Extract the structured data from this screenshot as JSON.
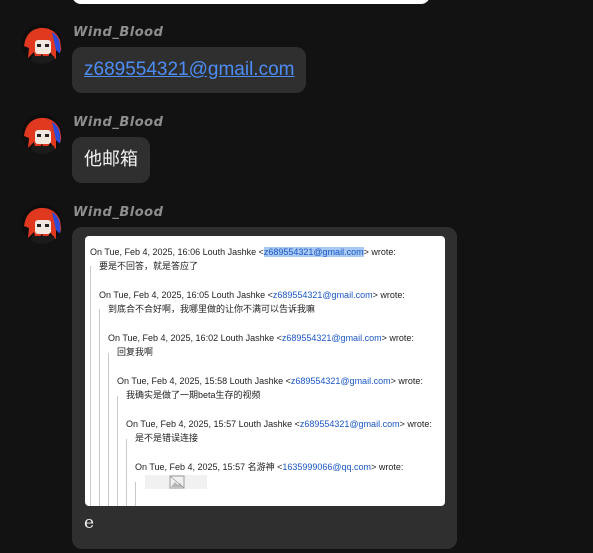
{
  "messages": [
    {
      "author": "Wind_Blood",
      "text": "z689554321@gmail.com",
      "type": "link"
    },
    {
      "author": "Wind_Blood",
      "text": "他邮箱",
      "type": "text"
    },
    {
      "author": "Wind_Blood",
      "type": "image",
      "caption": "e",
      "screenshot": {
        "quotes": [
          {
            "header_pre": "On Tue, Feb 4, 2025, 16:06 Louth Jashke <",
            "email": "z689554321@gmail.com",
            "header_post": "> wrote:",
            "body": "要是不回答，就是答应了"
          },
          {
            "header_pre": "On Tue, Feb 4, 2025, 16:05 Louth Jashke <",
            "email": "z689554321@gmail.com",
            "header_post": "> wrote:",
            "body": "到底合不合好啊，我哪里做的让你不满可以告诉我嘛"
          },
          {
            "header_pre": "On Tue, Feb 4, 2025, 16:02 Louth Jashke <",
            "email": "z689554321@gmail.com",
            "header_post": "> wrote:",
            "body": "回复我啊"
          },
          {
            "header_pre": "On Tue, Feb 4, 2025, 15:58 Louth Jashke <",
            "email": "z689554321@gmail.com",
            "header_post": "> wrote:",
            "body": "我确实是做了一期beta生存的视频"
          },
          {
            "header_pre": "On Tue, Feb 4, 2025, 15:57 Louth Jashke <",
            "email": "z689554321@gmail.com",
            "header_post": "> wrote:",
            "body": "是不是错误连接"
          },
          {
            "header_pre": "On Tue, Feb 4, 2025, 15:57 名游神 <",
            "email": "1635999066@qq.com",
            "header_post": "> wrote:",
            "body": ""
          }
        ]
      }
    }
  ]
}
